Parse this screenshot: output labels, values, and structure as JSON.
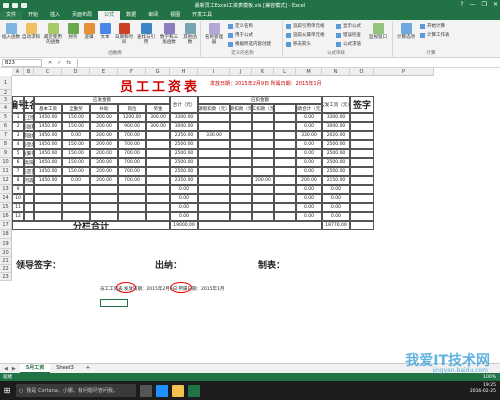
{
  "window": {
    "title": "最新员工Excel工资表模板.xls [兼容模式] - Excel",
    "help": "?",
    "minimize": "—",
    "restore": "❐",
    "close": "✕"
  },
  "tabs": [
    "文件",
    "开始",
    "插入",
    "页面布局",
    "公式",
    "数据",
    "审阅",
    "视图",
    "开发工具"
  ],
  "ribbon": {
    "insert_function": "插入函数",
    "autosum": "自动求和",
    "recent": "最近使用的函数",
    "financial": "财务",
    "logical": "逻辑",
    "text": "文本",
    "datetime": "日期和时间",
    "lookup": "查找与引用",
    "math": "数学和三角函数",
    "more": "其他函数",
    "name_manager": "名称管理器",
    "define_name": "定义名称",
    "use_in_formula": "用于公式",
    "create_from_sel": "根据所选内容创建",
    "trace_precedents": "追踪引用单元格",
    "trace_dependents": "追踪从属单元格",
    "remove_arrows": "移去箭头",
    "show_formulas": "显示公式",
    "error_check": "错误检查",
    "evaluate": "公式求值",
    "watch": "监视窗口",
    "calc_options": "计算选项",
    "calc_now": "开始计算",
    "calc_sheet": "计算工作表",
    "group_library": "函数库",
    "group_names": "定义的名称",
    "group_audit": "公式审核",
    "group_calc": "计算"
  },
  "formula_bar": {
    "name_box": "B23",
    "cancel": "✕",
    "enter": "✓",
    "fx": "fx"
  },
  "columns": [
    "A",
    "B",
    "C",
    "D",
    "E",
    "F",
    "G",
    "H",
    "I",
    "J",
    "K",
    "L",
    "M",
    "N",
    "O",
    "P"
  ],
  "rows": [
    "1",
    "2",
    "3",
    "4",
    "5",
    "6",
    "7",
    "8",
    "9",
    "10",
    "11",
    "12",
    "13",
    "14",
    "15",
    "16",
    "17",
    "18",
    "19",
    "20",
    "21",
    "22",
    "23"
  ],
  "sheet": {
    "title": "员工工资表",
    "date_line": "发放日期：2015年2月9日  所属日期：2015年1月",
    "headers": {
      "no": "编号",
      "name": "姓名",
      "payable_group": "应发金额",
      "deduct_group": "应扣金额",
      "base": "基本工资",
      "position": "全勤奖",
      "subsidy": "补助",
      "post": "岗位",
      "bonus": "奖金",
      "subtotal": "合计（元）",
      "leave": "请假扣款（元）",
      "late": "迟到扣款（元）",
      "absent": "旷工扣款（元）",
      "deduct_total": "扣款合计（元）",
      "actual": "实发工资（元）",
      "sign": "签字"
    },
    "data_rows": [
      {
        "no": "1",
        "name": "王卫明",
        "base": "1450.00",
        "position": "150.00",
        "subsidy": "200.00",
        "post": "1200.00",
        "bonus": "300.00",
        "subtotal": "3300.00",
        "leave": "",
        "late": "",
        "absent": "",
        "deduct_total": "0.00",
        "actual": "3300.00"
      },
      {
        "no": "2",
        "name": "马国鑫",
        "base": "1450.00",
        "position": "150.00",
        "subsidy": "200.00",
        "post": "900.00",
        "bonus": "300.00",
        "subtotal": "3000.00",
        "leave": "",
        "late": "",
        "absent": "",
        "deduct_total": "0.00",
        "actual": "3000.00"
      },
      {
        "no": "3",
        "name": "郝国斌",
        "base": "1450.00",
        "position": "0.00",
        "subsidy": "200.00",
        "post": "700.00",
        "bonus": "",
        "subtotal": "2350.00",
        "leave": "330.00",
        "late": "",
        "absent": "",
        "deduct_total": "330.00",
        "actual": "2020.00"
      },
      {
        "no": "4",
        "name": "马登高",
        "base": "1450.00",
        "position": "150.00",
        "subsidy": "200.00",
        "post": "700.00",
        "bonus": "",
        "subtotal": "2500.00",
        "leave": "",
        "late": "",
        "absent": "",
        "deduct_total": "0.00",
        "actual": "2500.00"
      },
      {
        "no": "5",
        "name": "张繁蒂",
        "base": "1450.00",
        "position": "150.00",
        "subsidy": "200.00",
        "post": "700.00",
        "bonus": "",
        "subtotal": "2500.00",
        "leave": "",
        "late": "",
        "absent": "",
        "deduct_total": "0.00",
        "actual": "2500.00"
      },
      {
        "no": "6",
        "name": "高阳",
        "base": "1450.00",
        "position": "150.00",
        "subsidy": "200.00",
        "post": "700.00",
        "bonus": "",
        "subtotal": "2500.00",
        "leave": "",
        "late": "",
        "absent": "",
        "deduct_total": "0.00",
        "actual": "2500.00"
      },
      {
        "no": "7",
        "name": "马苗苗",
        "base": "1450.00",
        "position": "150.00",
        "subsidy": "200.00",
        "post": "700.00",
        "bonus": "",
        "subtotal": "2500.00",
        "leave": "",
        "late": "",
        "absent": "",
        "deduct_total": "0.00",
        "actual": "2500.00"
      },
      {
        "no": "8",
        "name": "河森",
        "base": "1450.00",
        "position": "0.00",
        "subsidy": "200.00",
        "post": "700.00",
        "bonus": "",
        "subtotal": "2350.00",
        "leave": "",
        "late": "",
        "absent": "200.00",
        "deduct_total": "200.00",
        "actual": "2150.00"
      },
      {
        "no": "9",
        "name": "",
        "base": "",
        "position": "",
        "subsidy": "",
        "post": "",
        "bonus": "",
        "subtotal": "0.00",
        "leave": "",
        "late": "",
        "absent": "",
        "deduct_total": "0.00",
        "actual": "0.00"
      },
      {
        "no": "10",
        "name": "",
        "base": "",
        "position": "",
        "subsidy": "",
        "post": "",
        "bonus": "",
        "subtotal": "0.00",
        "leave": "",
        "late": "",
        "absent": "",
        "deduct_total": "0.00",
        "actual": "0.00"
      },
      {
        "no": "11",
        "name": "",
        "base": "",
        "position": "",
        "subsidy": "",
        "post": "",
        "bonus": "",
        "subtotal": "0.00",
        "leave": "",
        "late": "",
        "absent": "",
        "deduct_total": "0.00",
        "actual": "0.00"
      },
      {
        "no": "12",
        "name": "",
        "base": "",
        "position": "",
        "subsidy": "",
        "post": "",
        "bonus": "",
        "subtotal": "0.00",
        "leave": "",
        "late": "",
        "absent": "",
        "deduct_total": "0.00",
        "actual": "0.00"
      }
    ],
    "total_label": "分栏合计",
    "total_subtotal": "19000.00",
    "total_actual": "18770.00",
    "sign_leader": "领导签字：",
    "sign_cashier": "出纳：",
    "sign_maker": "制表：",
    "formula_text": "员工工资表 发放日期：2015年2月9日 所属日期：2015年1月"
  },
  "sheet_tabs": [
    "5月工资",
    "Sheet3"
  ],
  "add_sheet": "+",
  "status": {
    "ready": "就绪",
    "zoom": "100%"
  },
  "taskbar": {
    "search": "我是 Cortana，小娜。有问题尽管问我。",
    "time": "19:25",
    "date": "2016-02-25",
    "start": "⊞"
  },
  "watermark": {
    "text": "我爱IT技术网",
    "url": "jingyan.baidu.com"
  }
}
